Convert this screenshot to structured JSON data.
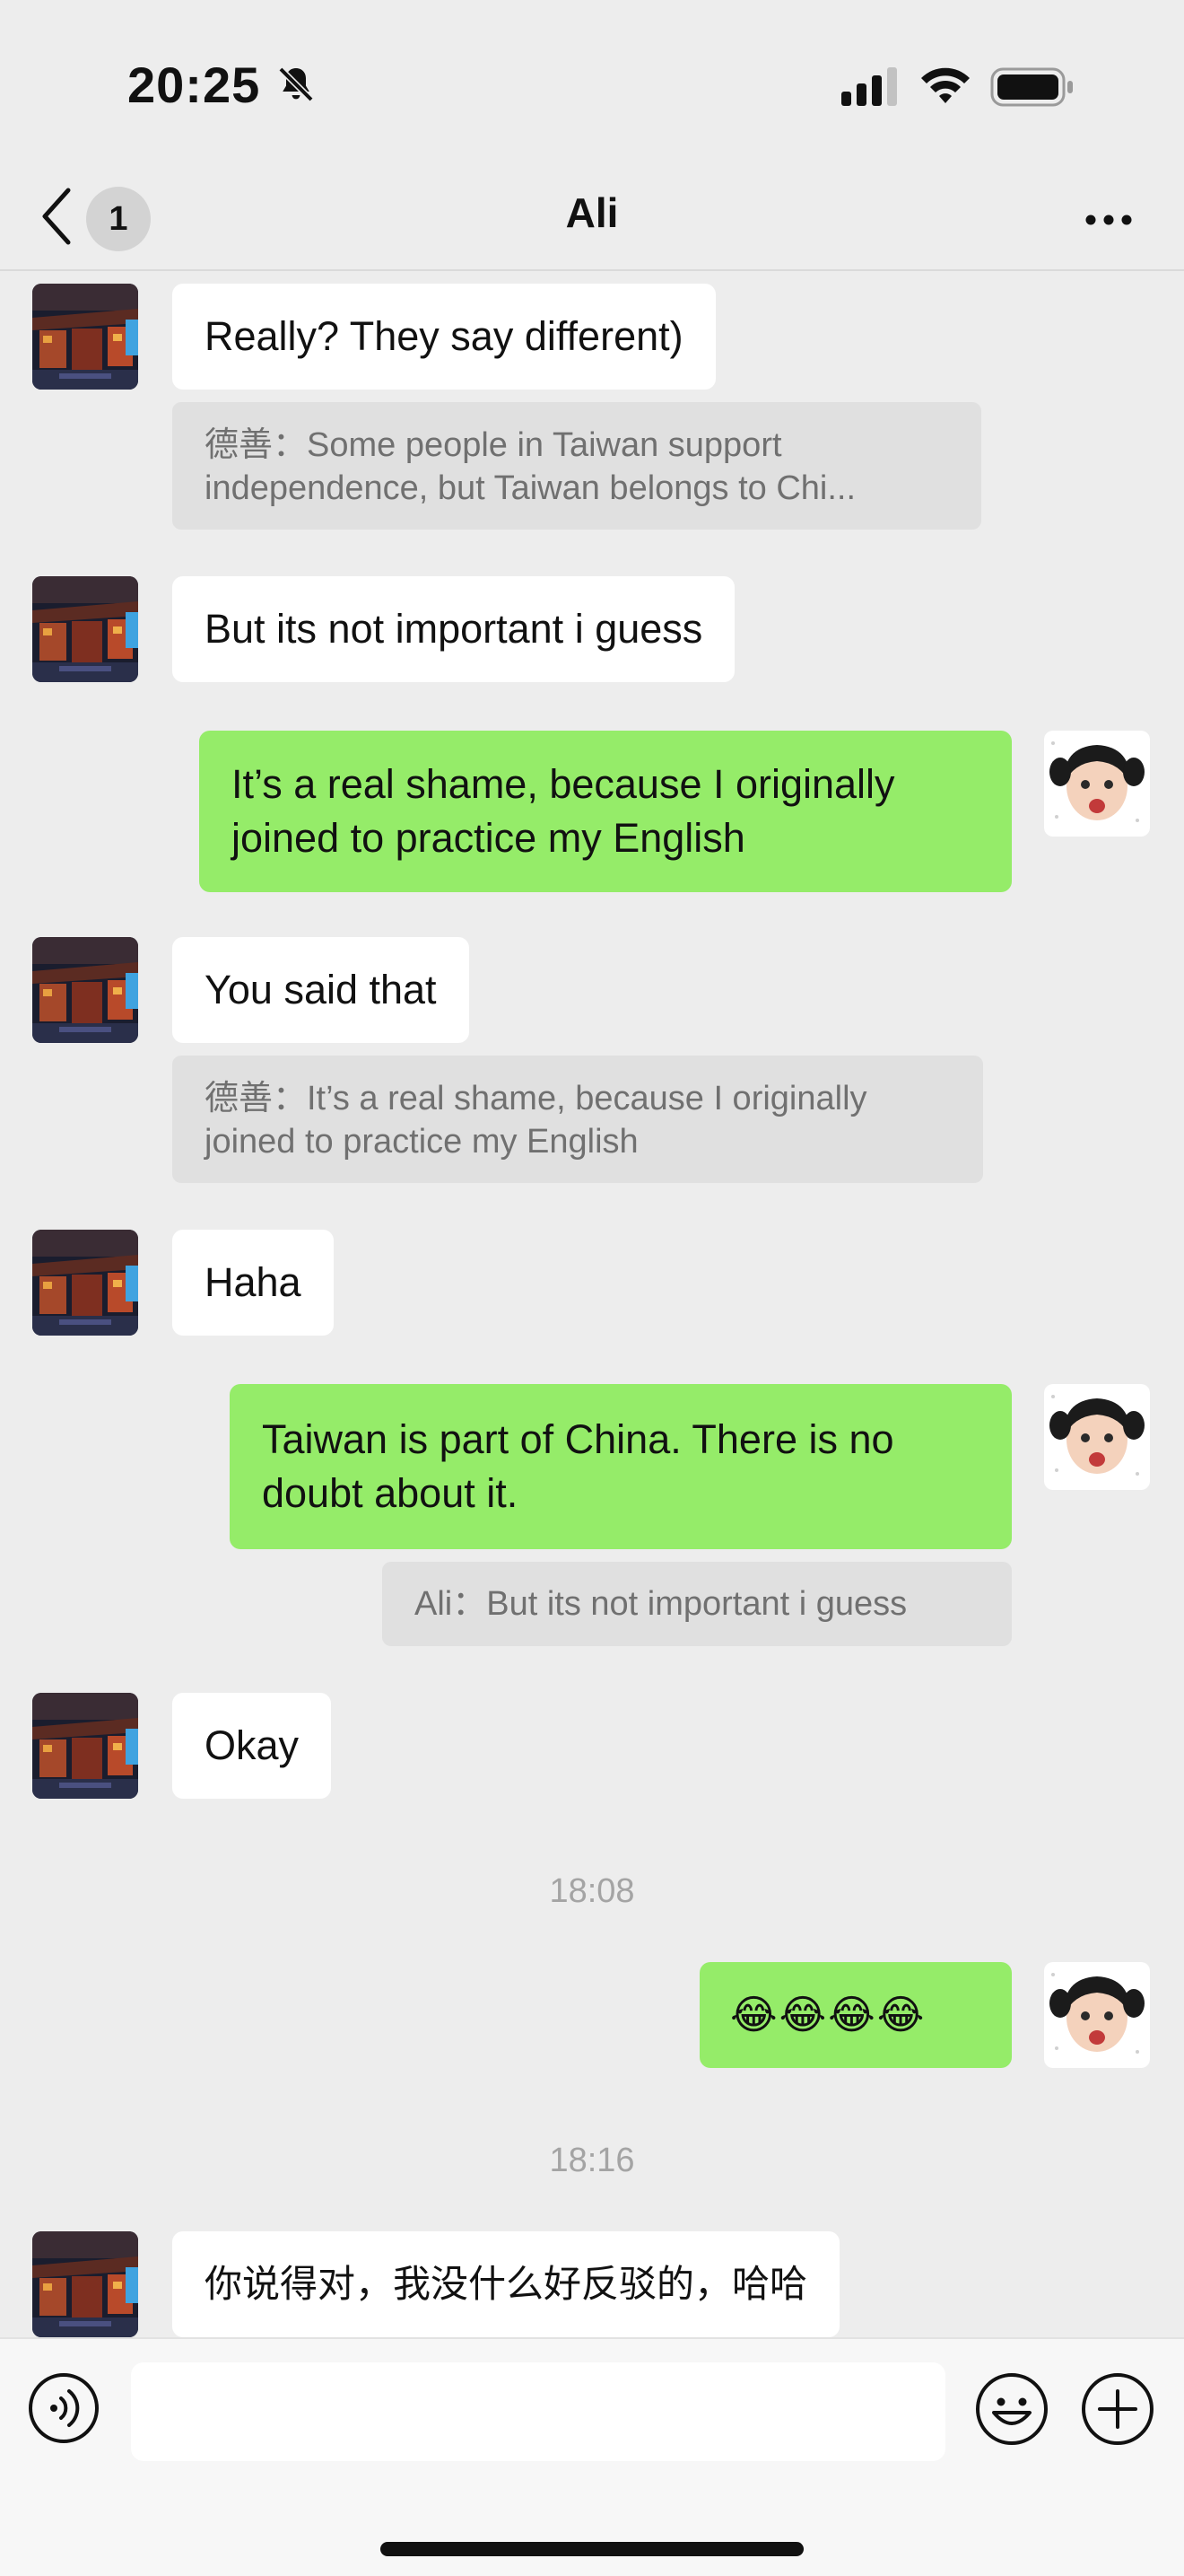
{
  "status_bar": {
    "time": "20:25",
    "icons": [
      "bell-slash-icon",
      "cellular-signal-icon",
      "wifi-icon",
      "battery-icon"
    ]
  },
  "nav": {
    "title": "Ali",
    "unread_count": "1",
    "icons": [
      "chevron-left-icon",
      "more-icon"
    ]
  },
  "messages": [
    {
      "dir": "in",
      "text": "Really? They say different)",
      "quote": "德善：Some people in Taiwan support independence, but Taiwan belongs to Chi..."
    },
    {
      "dir": "in",
      "text": "But its not important i guess"
    },
    {
      "dir": "out",
      "text": "It’s a real shame, because I originally joined to practice my English"
    },
    {
      "dir": "in",
      "text": "You said that",
      "quote": "德善：It’s a real shame, because I originally joined to practice my English"
    },
    {
      "dir": "in",
      "text": "Haha"
    },
    {
      "dir": "out",
      "text": "Taiwan is part of China. There is no doubt about it.",
      "quote": "Ali：But its not important i guess"
    },
    {
      "dir": "in",
      "text": "Okay"
    },
    {
      "dir": "time",
      "text": "18:08"
    },
    {
      "dir": "out",
      "text": "😂😂😂😂"
    },
    {
      "dir": "time",
      "text": "18:16"
    },
    {
      "dir": "in",
      "text": "你说得对，我没什么好反驳的，哈哈"
    }
  ],
  "input": {
    "value": "",
    "icons": [
      "voice-icon",
      "emoji-icon",
      "plus-icon"
    ]
  },
  "colors": {
    "background": "#ededed",
    "outgoing_bubble": "#95ec69",
    "incoming_bubble": "#ffffff",
    "quote_background": "#e0e0e0"
  }
}
